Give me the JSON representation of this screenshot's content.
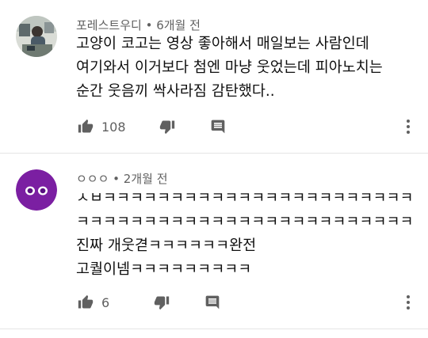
{
  "comments": [
    {
      "author": "포레스트우디",
      "time": "6개월 전",
      "meta_sep": " • ",
      "lines": [
        "고양이 코고는 영상 좋아해서 매일보는 사람인데",
        "여기와서 이거보다 첨엔 마냥 웃었는데 피아노치는",
        "순간 웃음끼 싹사라짐 감탄했다.."
      ],
      "likes": "108",
      "avatar": "photo-avatar"
    },
    {
      "author": "ㅇㅇㅇ",
      "time": "2개월 전",
      "meta_sep": " • ",
      "lines": [
        "ㅅㅂㅋㅋㅋㅋㅋㅋㅋㅋㅋㅋㅋㅋㅋㅋㅋㅋㅋㅋㅋㅋㅋㅋㅋㅋㅋ",
        "ㅋㅋㅋㅋㅋㅋㅋㅋㅋㅋㅋㅋㅋㅋㅋㅋㅋㅋㅋㅋㅋㅋㅋㅋㅋㅋㅋ",
        "진짜 개웃겯ㅋㅋㅋㅋㅋㅋ완전",
        "고퀄이넴ㅋㅋㅋㅋㅋㅋㅋㅋㅋ"
      ],
      "likes": "6",
      "avatar": "purple-eyes-avatar",
      "avatar_color": "#7b1fa2"
    }
  ],
  "icons": {
    "like": "thumbs-up-icon",
    "dislike": "thumbs-down-icon",
    "reply": "reply-icon",
    "more": "more-vert-icon"
  }
}
